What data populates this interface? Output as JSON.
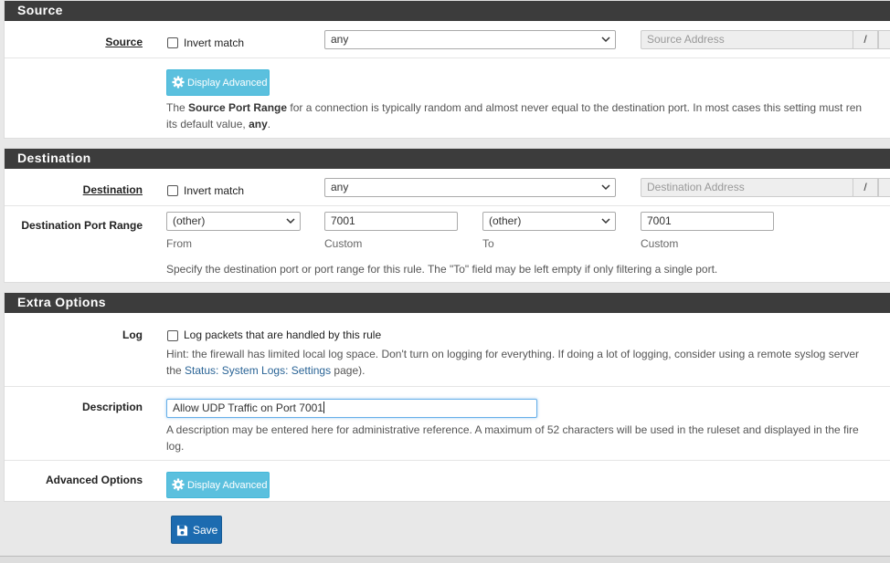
{
  "source": {
    "heading": "Source",
    "source_label": "Source",
    "invert_label": "Invert match",
    "type_value": "any",
    "address_placeholder": "Source Address",
    "slash": "/",
    "display_advanced": "Display Advanced",
    "help_pre": "The ",
    "help_bold": "Source Port Range",
    "help_mid": " for a connection is typically random and almost never equal to the destination port. In most cases this setting must ren",
    "help_line2_pre": "its default value, ",
    "help_line2_bold": "any",
    "help_line2_end": "."
  },
  "destination": {
    "heading": "Destination",
    "destination_label": "Destination",
    "invert_label": "Invert match",
    "type_value": "any",
    "address_placeholder": "Destination Address",
    "slash": "/",
    "port_range_label": "Destination Port Range",
    "from_select": "(other)",
    "from_custom": "7001",
    "to_select": "(other)",
    "to_custom": "7001",
    "from_label": "From",
    "custom_label_1": "Custom",
    "to_label": "To",
    "custom_label_2": "Custom",
    "help": "Specify the destination port or port range for this rule. The \"To\" field may be left empty if only filtering a single port."
  },
  "extra": {
    "heading": "Extra Options",
    "log_label": "Log",
    "log_checkbox_label": "Log packets that are handled by this rule",
    "log_hint_line1": "Hint: the firewall has limited local log space. Don't turn on logging for everything. If doing a lot of logging, consider using a remote syslog server",
    "log_hint_line2_pre": "the ",
    "log_hint_link": "Status: System Logs: Settings",
    "log_hint_line2_end": " page).",
    "description_label": "Description",
    "description_value": "Allow UDP Traffic on Port 7001",
    "description_help_line1": "A description may be entered here for administrative reference. A maximum of 52 characters will be used in the ruleset and displayed in the fire",
    "description_help_line2": "log.",
    "advanced_label": "Advanced Options",
    "display_advanced": "Display Advanced"
  },
  "save_label": "Save",
  "colors": {
    "heading_bg": "#3c3c3c",
    "info_button": "#5bc0de",
    "save_button": "#1c6bb0",
    "link": "#2a6496"
  }
}
